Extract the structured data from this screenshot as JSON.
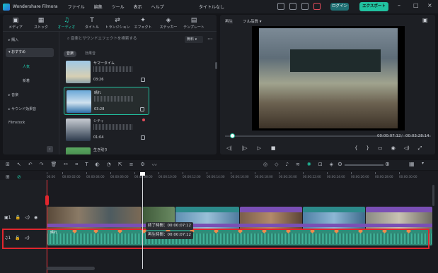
{
  "titlebar": {
    "app": "Wondershare Filmora",
    "menu": [
      "ファイル",
      "編集",
      "ツール",
      "表示",
      "ヘルプ"
    ],
    "project_title": "タイトルなし",
    "login": "ログイン",
    "export": "エクスポート"
  },
  "library": {
    "tabs": [
      {
        "icon": "▣",
        "label": "メディア"
      },
      {
        "icon": "▦",
        "label": "ストック"
      },
      {
        "icon": "♫",
        "label": "オーディオ"
      },
      {
        "icon": "T",
        "label": "タイトル"
      },
      {
        "icon": "⇄",
        "label": "トランジション"
      },
      {
        "icon": "✦",
        "label": "エフェクト"
      },
      {
        "icon": "◈",
        "label": "ステッカー"
      },
      {
        "icon": "▤",
        "label": "テンプレート"
      }
    ],
    "categories": [
      "購入",
      "おすすめ",
      "人気",
      "新着",
      "音楽",
      "サウンド効果音",
      "Filmstock"
    ],
    "search_placeholder": "音楽とサウンドエフェクトを検索する",
    "filter": "無料",
    "chips": [
      "音楽",
      "効果音"
    ],
    "items": [
      {
        "name": "サマータイム",
        "duration": "03:26"
      },
      {
        "name": "晴れ",
        "duration": "03:28"
      },
      {
        "name": "シティ",
        "duration": "01:04"
      },
      {
        "name": "生き残り",
        "duration": ""
      }
    ]
  },
  "player": {
    "label": "再生",
    "quality": "フル品質",
    "current_time": "00:00:07:12",
    "total_time": "00:03:28:14"
  },
  "timeline": {
    "ruler": [
      "00:00",
      "00:00:02:00",
      "00:00:04:00",
      "00:00:06:00",
      "00:00:08:00",
      "00:00:10:00",
      "00:00:12:00",
      "00:00:14:00",
      "00:00:16:00",
      "00:00:18:00",
      "00:00:20:00",
      "00:00:22:00",
      "00:00:24:00",
      "00:00:26:00",
      "00:00:28:00",
      "00:00:30:00"
    ],
    "video_track_label": "1",
    "audio_track_label": "1",
    "end_time_label": "終了時間：00:00:07:12",
    "play_time_label": "再生時間：00:00:07:12",
    "audio_clip_name": "晴れ",
    "video_clip_label": "pexels-pixabay-259..."
  },
  "colors": {
    "accent": "#21c2a0",
    "highlight": "#e1262d",
    "audio": "#2f8c78"
  }
}
